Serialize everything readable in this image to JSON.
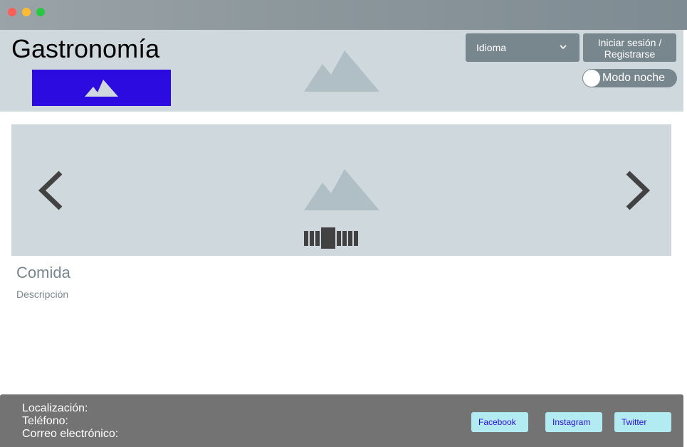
{
  "window": {
    "controls": [
      "close",
      "minimize",
      "maximize"
    ]
  },
  "header": {
    "title": "Gastronomía",
    "language_select": {
      "label": "Idioma",
      "icon": "chevron-down-icon"
    },
    "login_button": {
      "line1": "Iniciar sesión /",
      "line2": "Registrarse"
    },
    "night_mode": {
      "label": "Modo noche",
      "on": false
    }
  },
  "carousel": {
    "prev_icon": "chevron-left-icon",
    "next_icon": "chevron-right-icon",
    "indicator_count": 8,
    "active_index": 3
  },
  "content": {
    "title": "Comida",
    "description": "Descripción"
  },
  "footer": {
    "location_label": "Localización:",
    "phone_label": "Teléfono:",
    "email_label": "Correo electrónico:",
    "social": [
      "Facebook",
      "Instagram",
      "Twitter"
    ]
  },
  "colors": {
    "header_bg": "#cfd8dc",
    "button_bg": "#78878e",
    "logo_bg": "#2b0bdf",
    "footer_bg": "#737373",
    "social_bg": "#b3ebf2"
  }
}
